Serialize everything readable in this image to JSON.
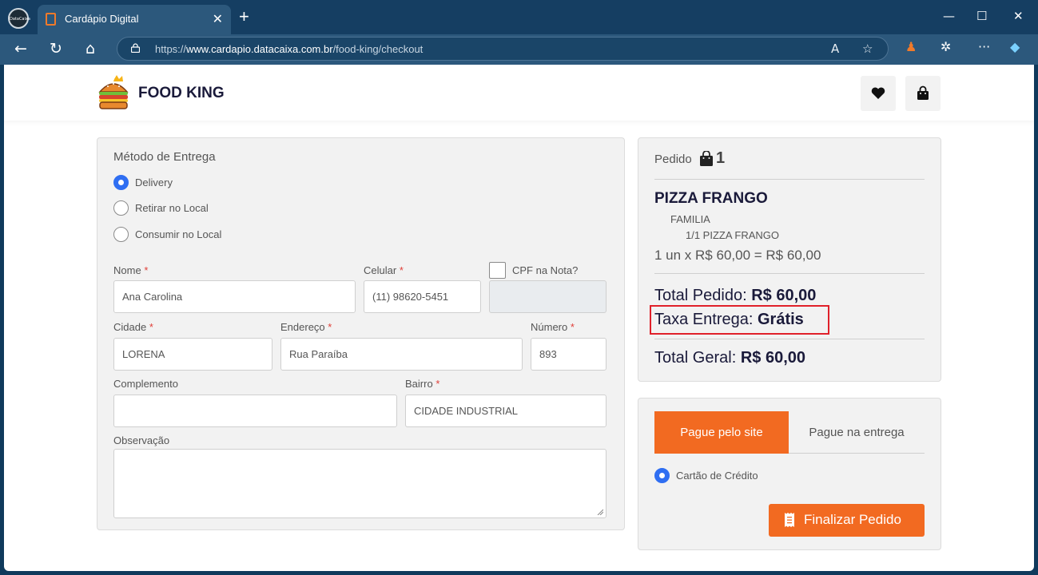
{
  "browser": {
    "profile_label": "DataCaixa",
    "tab_title": "Cardápio Digital",
    "tab_close": "✕",
    "new_tab": "+",
    "url_prefix": "https://",
    "url_host": "www.cardapio.datacaixa.com.br",
    "url_path": "/food-king/checkout",
    "minimize": "—",
    "maximize": "☐",
    "close": "✕",
    "more": "···"
  },
  "header": {
    "brand": "FOOD KING"
  },
  "delivery": {
    "title": "Método de Entrega",
    "options": [
      {
        "label": "Delivery",
        "selected": true
      },
      {
        "label": "Retirar no Local",
        "selected": false
      },
      {
        "label": "Consumir no Local",
        "selected": false
      }
    ]
  },
  "form": {
    "nome_label": "Nome",
    "nome_value": "Ana Carolina",
    "celular_label": "Celular",
    "celular_value": "(11) 98620-5451",
    "cpf_label": "CPF na Nota?",
    "cidade_label": "Cidade",
    "cidade_value": "LORENA",
    "endereco_label": "Endereço",
    "endereco_value": "Rua Paraíba",
    "numero_label": "Número",
    "numero_value": "893",
    "complemento_label": "Complemento",
    "complemento_value": "",
    "bairro_label": "Bairro",
    "bairro_value": "CIDADE INDUSTRIAL",
    "observacao_label": "Observação",
    "required_mark": "*"
  },
  "summary": {
    "heading": "Pedido",
    "count": "1",
    "item_name": "PIZZA FRANGO",
    "item_variant": "FAMILIA",
    "item_detail": "1/1 PIZZA FRANGO",
    "item_line": "1 un x R$ 60,00 = R$ 60,00",
    "total_pedido_label": "Total Pedido:",
    "total_pedido_value": "R$ 60,00",
    "taxa_label": "Taxa Entrega:",
    "taxa_value": "Grátis",
    "total_geral_label": "Total Geral:",
    "total_geral_value": "R$ 60,00"
  },
  "payment": {
    "tab_site": "Pague pelo site",
    "tab_entrega": "Pague na entrega",
    "method": "Cartão de Crédito",
    "finalize": "Finalizar Pedido"
  },
  "colors": {
    "accent": "#f26a21",
    "radio": "#2f6ef2",
    "highlight": "#e0202a",
    "chrome": "#153e62"
  }
}
